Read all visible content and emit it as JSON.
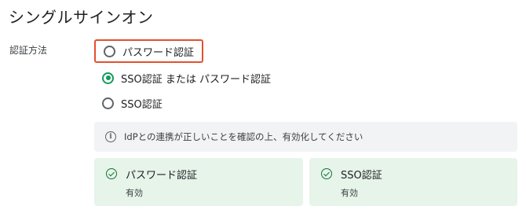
{
  "title": "シングルサインオン",
  "auth_method": {
    "label": "認証方法",
    "options": [
      {
        "label": "パスワード認証",
        "selected": false,
        "highlighted": true
      },
      {
        "label": "SSO認証 または パスワード認証",
        "selected": true,
        "highlighted": false
      },
      {
        "label": "SSO認証",
        "selected": false,
        "highlighted": false
      }
    ]
  },
  "info": {
    "icon": "info-icon",
    "text": "IdPとの連携が正しいことを確認の上、有効化してください"
  },
  "status_cards": [
    {
      "title": "パスワード認証",
      "status": "有効",
      "icon": "check-circle-icon"
    },
    {
      "title": "SSO認証",
      "status": "有効",
      "icon": "check-circle-icon"
    }
  ],
  "colors": {
    "accent": "#0f9d58",
    "highlight_border": "#e2512f",
    "info_bg": "#f1f3f4",
    "card_bg": "#e6f4ea"
  }
}
